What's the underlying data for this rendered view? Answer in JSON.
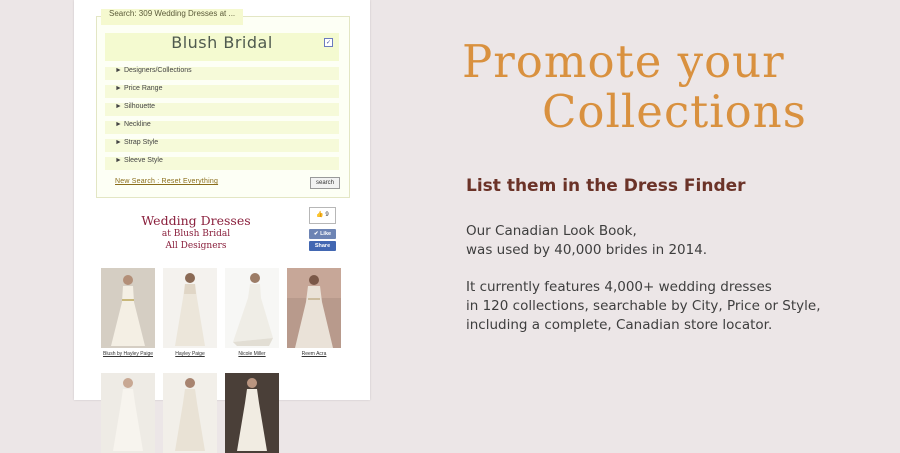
{
  "finder": {
    "search_label": "Search: 309 Wedding Dresses at ...",
    "store_name": "Blush Bridal",
    "filters": [
      "Designers/Collections",
      "Price Range",
      "Silhouette",
      "Neckline",
      "Strap Style",
      "Sleeve Style"
    ],
    "new_search_label": "New Search : Reset Everything",
    "search_button": "search"
  },
  "listing": {
    "title": "Wedding Dresses",
    "store_line": "at Blush Bridal",
    "designer_line": "All Designers"
  },
  "social": {
    "like_count": "9",
    "like_label": "Like",
    "share_label": "Share"
  },
  "dresses": [
    {
      "name": "Blush by Hayley Paige"
    },
    {
      "name": "Hayley Paige"
    },
    {
      "name": "Nicole Miller"
    },
    {
      "name": "Reem Acra"
    }
  ],
  "promo": {
    "title_line1": "Promote your",
    "title_line2": "Collections",
    "subheading": "List them in the Dress Finder",
    "para1_line1": "Our Canadian Look Book,",
    "para1_line2": "was used by 40,000 brides in 2014.",
    "para2_line1": "It currently features 4,000+ wedding dresses",
    "para2_line2": "in 120 collections, searchable by City, Price or Style,",
    "para2_line3": "including a complete, Canadian store locator."
  },
  "colors": {
    "background": "#ece6e7",
    "promo_title": "#d9913f",
    "subheading": "#6b3328",
    "listing_title": "#8a1f3c"
  }
}
